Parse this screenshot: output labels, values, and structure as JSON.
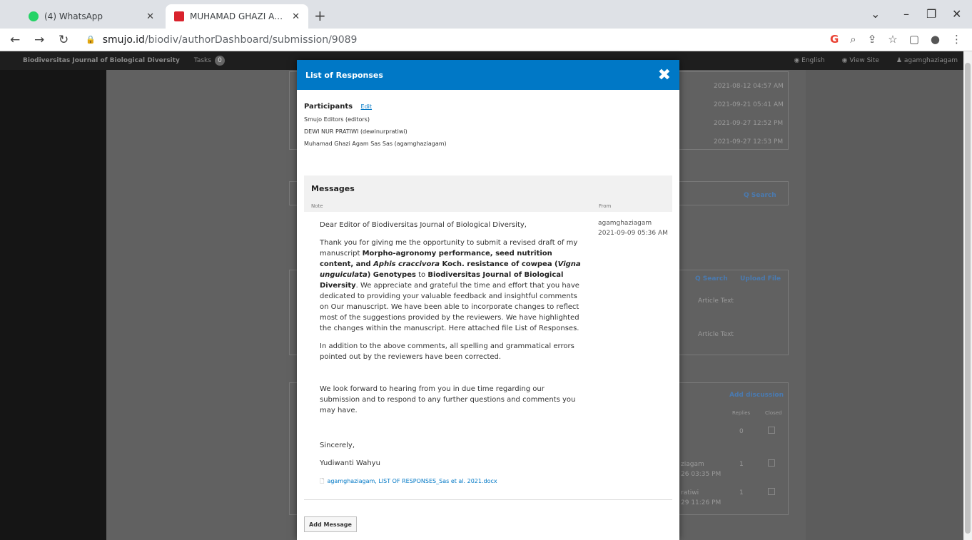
{
  "browser": {
    "tabs": [
      {
        "title": "(4) WhatsApp",
        "favicon_color": "#25d366"
      },
      {
        "title": "MUHAMAD GHAZI AGAM SAS, M",
        "favicon_color": "#d9232d"
      }
    ],
    "url_host": "smujo.id",
    "url_path": "/biodiv/authorDashboard/submission/9089"
  },
  "site": {
    "name": "Biodiversitas Journal of Biological Diversity",
    "tasks_label": "Tasks",
    "tasks_count": "0",
    "language": "English",
    "view_site": "View Site",
    "user": "agamghaziagam"
  },
  "background": {
    "dates": [
      "2021-08-12 04:57 AM",
      "2021-09-21 05:41 AM",
      "2021-09-27 12:52 PM",
      "2021-09-27 12:53 PM"
    ],
    "search1": "Q Search",
    "search2": "Q Search",
    "upload_file": "Upload File",
    "article_text_1": "Article Text",
    "article_text_2": "Article Text",
    "add_discussion": "Add discussion",
    "replies_label": "Replies",
    "closed_label": "Closed",
    "reply_count_0": "0",
    "reply_row1_from": "ziagam",
    "reply_row1_date": "26 03:35 PM",
    "reply_row1_count": "1",
    "reply_row2_from": "ratiwi",
    "reply_row2_date": "29 11:26 PM",
    "reply_row2_count": "1"
  },
  "modal": {
    "title": "List of Responses",
    "participants_title": "Participants",
    "edit_link": "Edit",
    "participants": [
      "Smujo Editors (editors)",
      "DEWI NUR PRATIWI (dewinurpratiwi)",
      "Muhamad Ghazi Agam Sas Sas (agamghaziagam)"
    ],
    "messages_title": "Messages",
    "col_note": "Note",
    "col_from": "From",
    "message": {
      "greeting": "Dear Editor of Biodiversitas Journal of Biological Diversity,",
      "p1_a": "Thank you for giving me the opportunity to submit a revised draft of my manuscript ",
      "p1_b": "Morpho-agronomy performance, seed nutrition content, and ",
      "p1_c": "Aphis craccivora",
      "p1_d": " Koch. resistance of cowpea (",
      "p1_e": "Vigna unguiculata",
      "p1_f": ") Genotypes",
      "p1_g": " to ",
      "p1_h": "Biodiversitas Journal of Biological Diversity",
      "p1_i": ". We appreciate and grateful the time and effort that you have dedicated to providing your valuable feedback and insightful comments on Our manuscript. We have been able to incorporate changes to reflect most of the suggestions provided by the reviewers. We have highlighted the changes within the manuscript. Here attached file List of Responses.",
      "p2": "In addition to the above comments, all spelling and grammatical errors pointed out by the reviewers have been corrected.",
      "p3": "We look forward to hearing from you in due time regarding our submission and to respond to any further questions and comments you may have.",
      "closing": "Sincerely,",
      "signature": "Yudiwanti Wahyu",
      "attachment": "agamghaziagam, LIST OF RESPONSES_Sas et al. 2021.docx",
      "from_user": "agamghaziagam",
      "from_date": "2021-09-09 05:36 AM"
    },
    "add_message": "Add Message"
  }
}
